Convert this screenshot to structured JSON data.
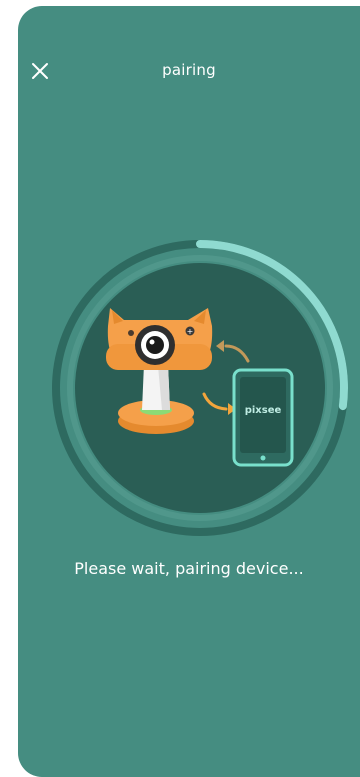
{
  "header": {
    "title": "pairing",
    "close_icon": "close-icon"
  },
  "pairing": {
    "progress": 0.27,
    "phone_brand": "pixsee",
    "status_text": "Please wait, pairing device..."
  },
  "colors": {
    "background": "#458d81",
    "ring_track": "#2e6a60",
    "ring_progress": "#8fdad0",
    "inner_circle": "#2a5e55",
    "camera_orange": "#f5a04a",
    "phone_border": "#79e0cc",
    "arrow_orange": "#f3a53c"
  }
}
